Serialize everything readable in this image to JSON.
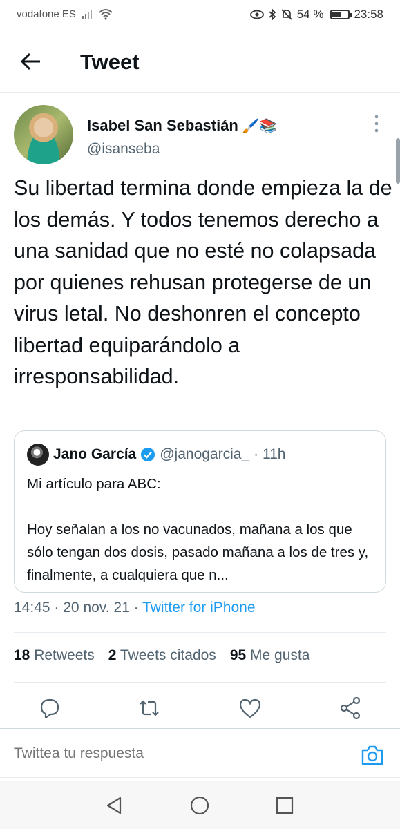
{
  "status_bar": {
    "carrier": "vodafone ES",
    "battery": "54 %",
    "time": "23:58"
  },
  "header": {
    "title": "Tweet"
  },
  "author": {
    "name": "Isabel San Sebastián",
    "name_emoji": "🖌️📚",
    "handle": "@isanseba"
  },
  "tweet": {
    "text": "Su libertad termina donde empieza la de los demás. Y todos tenemos derecho a una sanidad que no esté no colapsada por quienes rehusan protegerse de un virus letal. No deshonren el concepto libertad equiparándolo a irresponsabilidad."
  },
  "quote": {
    "name": "Jano García",
    "handle": "@janogarcia_",
    "time": "· 11h",
    "line1": "Mi artículo para ABC:",
    "body": "Hoy señalan a los no vacunados, mañana a los que sólo tengan dos dosis, pasado mañana a los de tres y, finalmente, a cualquiera que n..."
  },
  "meta": {
    "time": "14:45",
    "date": "20 nov. 21",
    "dot": "·",
    "source": "Twitter for iPhone"
  },
  "stats": {
    "retweets_count": "18",
    "retweets_label": "Retweets",
    "quotes_count": "2",
    "quotes_label": "Tweets citados",
    "likes_count": "95",
    "likes_label": "Me gusta"
  },
  "reply": {
    "placeholder": "Twittea tu respuesta"
  },
  "colors": {
    "accent": "#1d9bf0",
    "text": "#0f1419",
    "secondary": "#536471"
  }
}
